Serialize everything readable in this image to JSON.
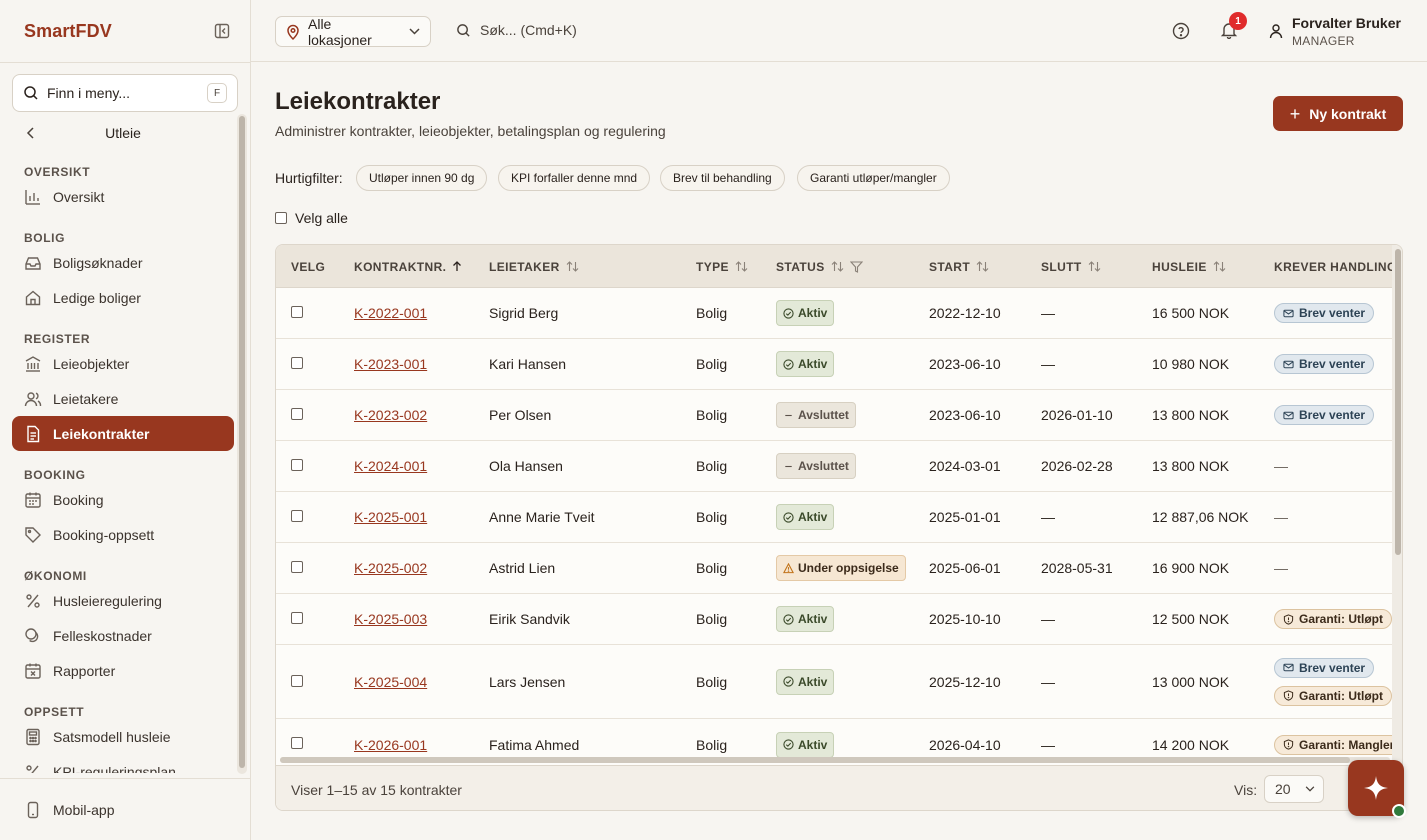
{
  "app": {
    "name": "SmartFDV"
  },
  "menu_search": {
    "placeholder": "Finn i meny...",
    "shortcut": "F"
  },
  "nav": {
    "back_label": "Utleie",
    "groups": [
      {
        "title": "OVERSIKT",
        "items": [
          {
            "label": "Oversikt",
            "icon": "chart-icon"
          }
        ]
      },
      {
        "title": "BOLIG",
        "items": [
          {
            "label": "Boligsøknader",
            "icon": "inbox-icon"
          },
          {
            "label": "Ledige boliger",
            "icon": "home-icon"
          }
        ]
      },
      {
        "title": "REGISTER",
        "items": [
          {
            "label": "Leieobjekter",
            "icon": "building-icon"
          },
          {
            "label": "Leietakere",
            "icon": "users-icon"
          },
          {
            "label": "Leiekontrakter",
            "icon": "document-icon",
            "active": true
          }
        ]
      },
      {
        "title": "BOOKING",
        "items": [
          {
            "label": "Booking",
            "icon": "calendar-icon"
          },
          {
            "label": "Booking-oppsett",
            "icon": "tag-icon"
          }
        ]
      },
      {
        "title": "ØKONOMI",
        "items": [
          {
            "label": "Husleieregulering",
            "icon": "percent-icon"
          },
          {
            "label": "Felleskostnader",
            "icon": "coins-icon"
          },
          {
            "label": "Rapporter",
            "icon": "calendar-x-icon"
          }
        ]
      },
      {
        "title": "OPPSETT",
        "items": [
          {
            "label": "Satsmodell husleie",
            "icon": "calculator-icon"
          },
          {
            "label": "KPI-reguleringsplan",
            "icon": "percent-icon"
          }
        ]
      }
    ],
    "footer_item": "Mobil-app"
  },
  "topbar": {
    "location": "Alle lokasjoner",
    "search_placeholder": "Søk... (Cmd+K)",
    "notifications": "1",
    "user_name": "Forvalter Bruker",
    "user_role": "MANAGER"
  },
  "page": {
    "title": "Leiekontrakter",
    "subtitle": "Administrer kontrakter, leieobjekter, betalingsplan og regulering",
    "new_button": "Ny kontrakt",
    "quick_filter_label": "Hurtigfilter:",
    "quick_filters": [
      "Utløper innen 90 dg",
      "KPI forfaller denne mnd",
      "Brev til behandling",
      "Garanti utløper/mangler"
    ],
    "select_all": "Velg alle"
  },
  "table": {
    "headers": {
      "select": "VELG",
      "number": "KONTRAKTNR.",
      "tenant": "LEIETAKER",
      "type": "TYPE",
      "status": "STATUS",
      "start": "START",
      "end": "SLUTT",
      "rent": "HUSLEIE",
      "action": "KREVER HANDLING"
    },
    "rows": [
      {
        "number": "K-2022-001",
        "tenant": "Sigrid Berg",
        "type": "Bolig",
        "status": "Aktiv",
        "status_kind": "aktiv",
        "start": "2022-12-10",
        "end": "—",
        "rent": "16 500 NOK",
        "actions": [
          {
            "label": "Brev venter",
            "kind": "brev"
          }
        ]
      },
      {
        "number": "K-2023-001",
        "tenant": "Kari Hansen",
        "type": "Bolig",
        "status": "Aktiv",
        "status_kind": "aktiv",
        "start": "2023-06-10",
        "end": "—",
        "rent": "10 980 NOK",
        "actions": [
          {
            "label": "Brev venter",
            "kind": "brev"
          }
        ]
      },
      {
        "number": "K-2023-002",
        "tenant": "Per Olsen",
        "type": "Bolig",
        "status": "Avsluttet",
        "status_kind": "avsluttet",
        "start": "2023-06-10",
        "end": "2026-01-10",
        "rent": "13 800 NOK",
        "actions": [
          {
            "label": "Brev venter",
            "kind": "brev"
          }
        ]
      },
      {
        "number": "K-2024-001",
        "tenant": "Ola Hansen",
        "type": "Bolig",
        "status": "Avsluttet",
        "status_kind": "avsluttet",
        "start": "2024-03-01",
        "end": "2026-02-28",
        "rent": "13 800 NOK",
        "actions": [],
        "no_action": "—"
      },
      {
        "number": "K-2025-001",
        "tenant": "Anne Marie Tveit",
        "type": "Bolig",
        "status": "Aktiv",
        "status_kind": "aktiv",
        "start": "2025-01-01",
        "end": "—",
        "rent": "12 887,06 NOK",
        "actions": [],
        "no_action": "—"
      },
      {
        "number": "K-2025-002",
        "tenant": "Astrid Lien",
        "type": "Bolig",
        "status": "Under oppsigelse",
        "status_kind": "under",
        "start": "2025-06-01",
        "end": "2028-05-31",
        "rent": "16 900 NOK",
        "actions": [],
        "no_action": "—"
      },
      {
        "number": "K-2025-003",
        "tenant": "Eirik Sandvik",
        "type": "Bolig",
        "status": "Aktiv",
        "status_kind": "aktiv",
        "start": "2025-10-10",
        "end": "—",
        "rent": "12 500 NOK",
        "actions": [
          {
            "label": "Garanti: Utløpt",
            "kind": "garanti"
          }
        ]
      },
      {
        "number": "K-2025-004",
        "tenant": "Lars Jensen",
        "type": "Bolig",
        "status": "Aktiv",
        "status_kind": "aktiv",
        "start": "2025-12-10",
        "end": "—",
        "rent": "13 000 NOK",
        "actions": [
          {
            "label": "Brev venter",
            "kind": "brev"
          },
          {
            "label": "Garanti: Utløpt",
            "kind": "garanti"
          }
        ]
      },
      {
        "number": "K-2026-001",
        "tenant": "Fatima Ahmed",
        "type": "Bolig",
        "status": "Aktiv",
        "status_kind": "aktiv",
        "start": "2026-04-10",
        "end": "—",
        "rent": "14 200 NOK",
        "actions": [
          {
            "label": "Garanti: Mangler",
            "kind": "garanti"
          }
        ]
      }
    ],
    "footer_count": "Viser 1–15 av 15 kontrakter",
    "page_size_label": "Vis:",
    "page_size": "20"
  },
  "colors": {
    "brand": "#98371f",
    "badge": "#e02b2b",
    "online": "#2f7a3c"
  }
}
